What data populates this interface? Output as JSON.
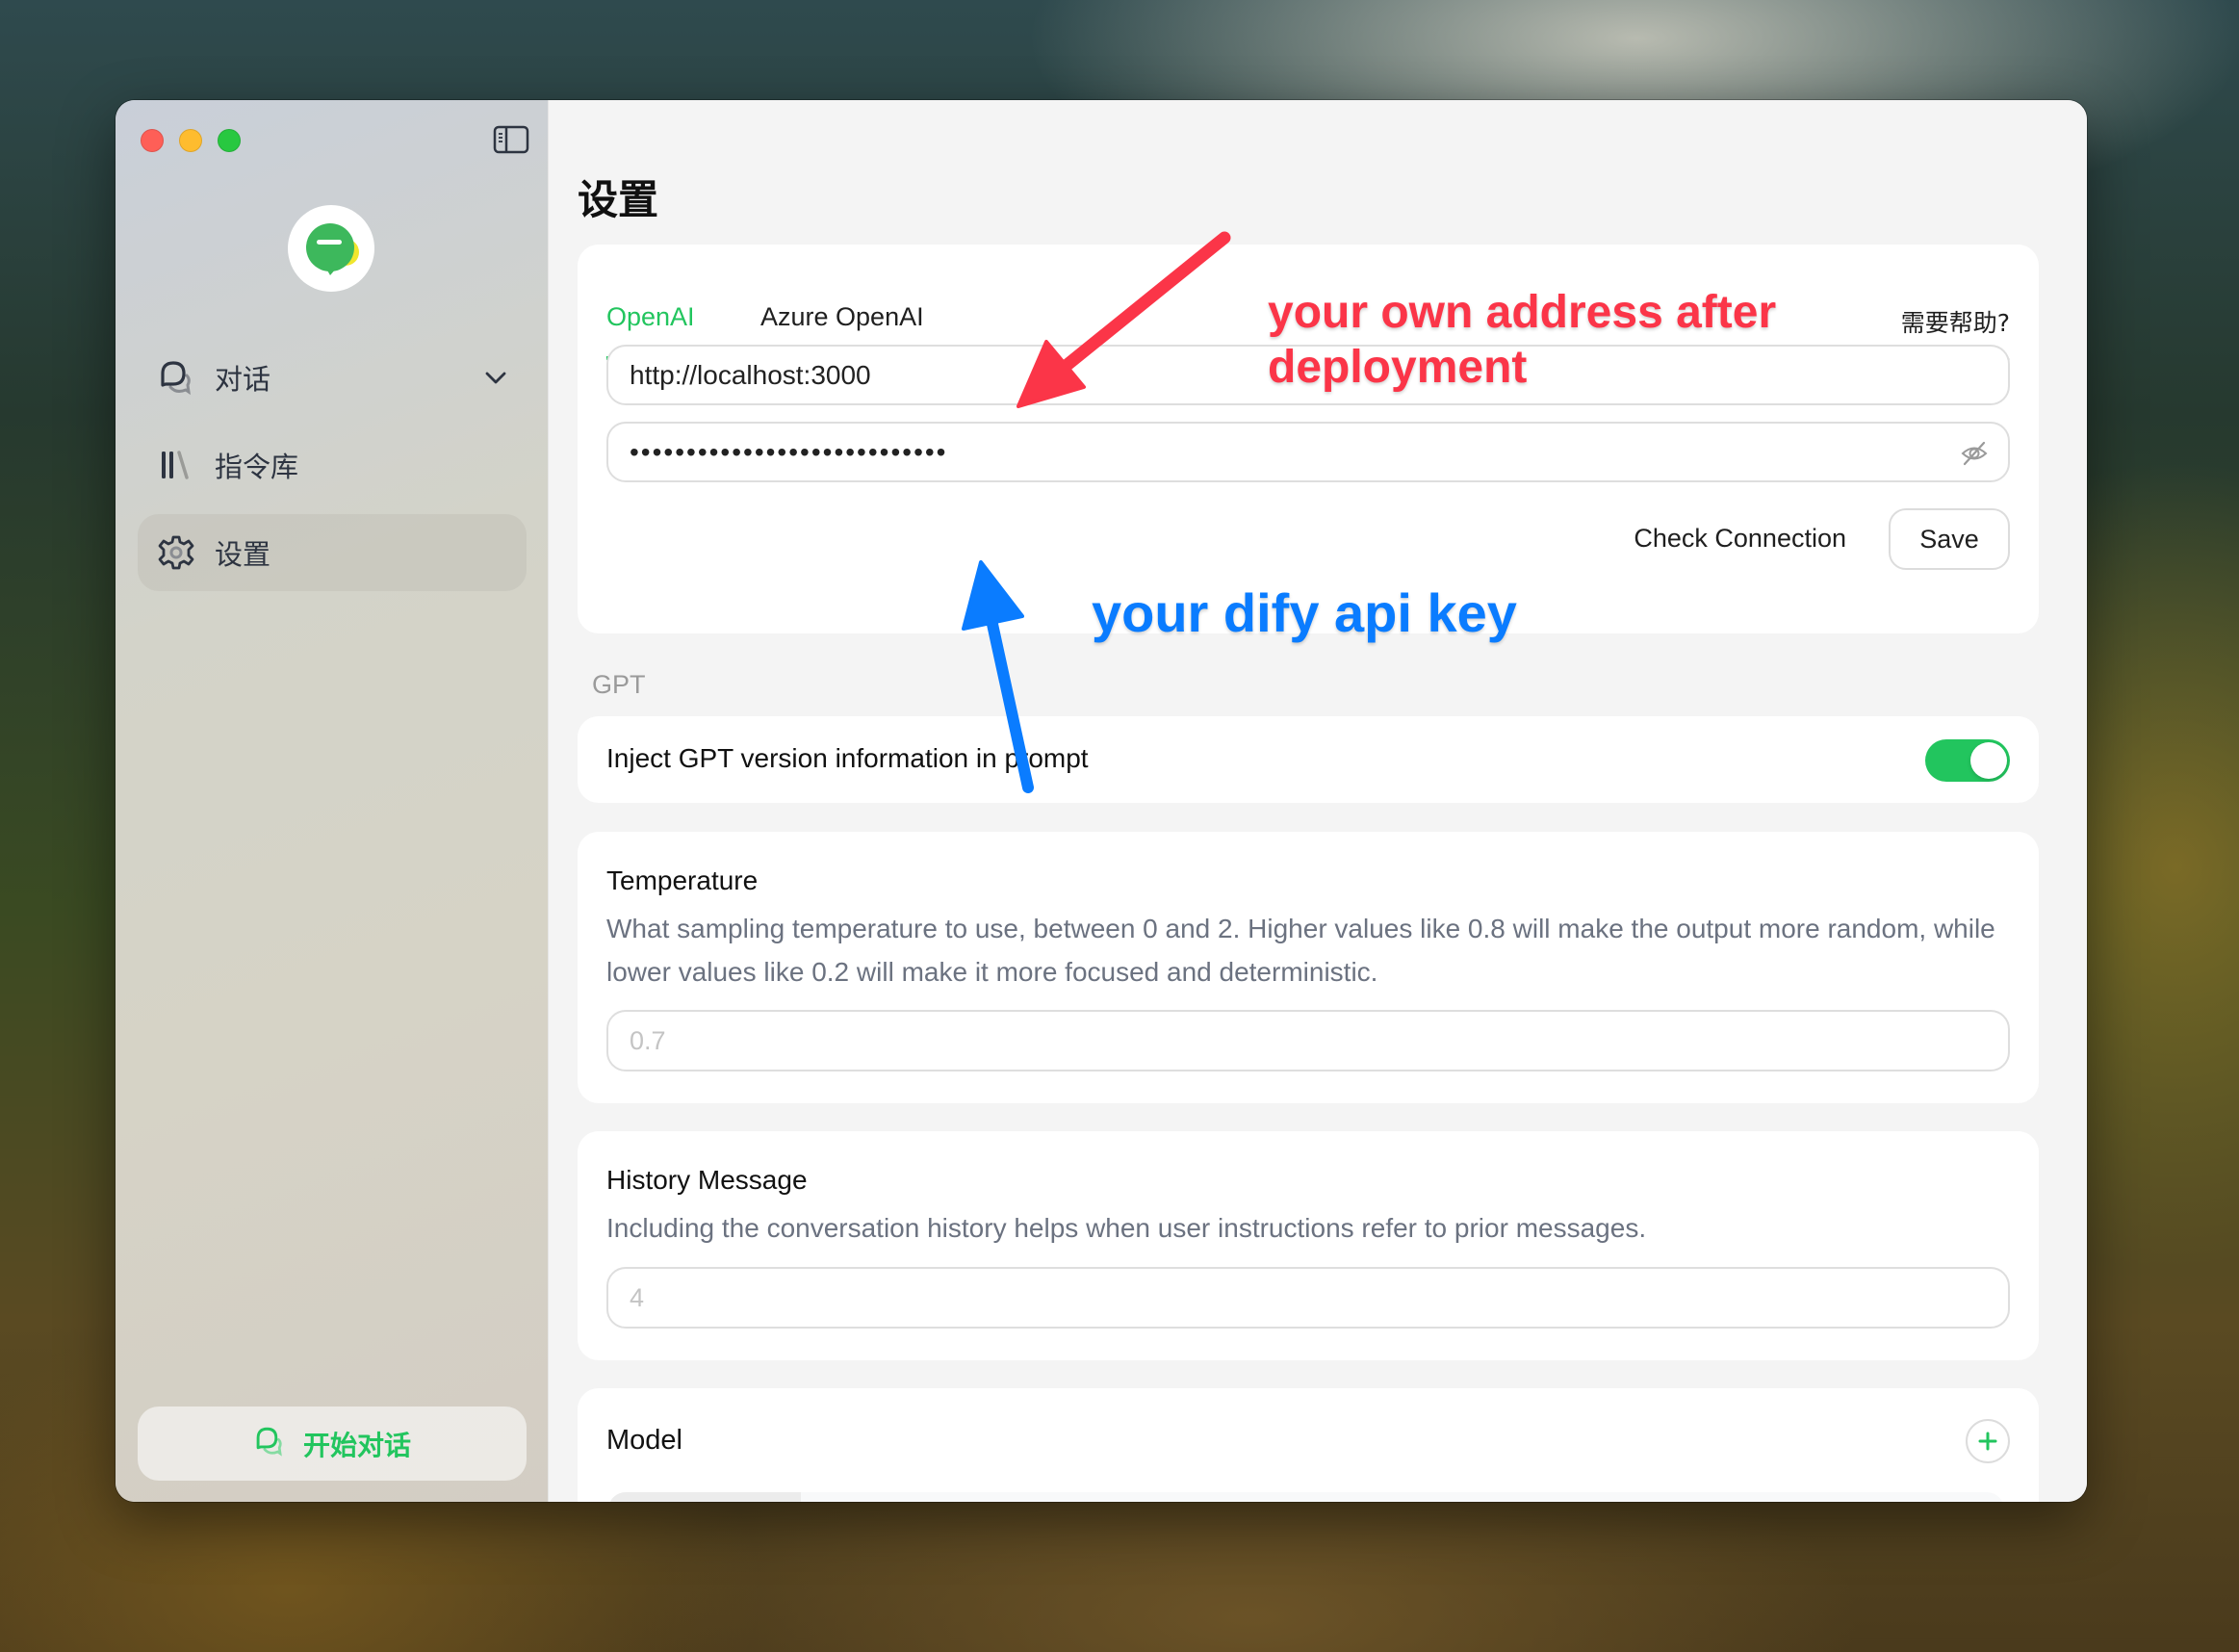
{
  "window": {
    "controls": [
      "close",
      "minimize",
      "maximize"
    ],
    "sidebar_toggle_icon": "sidebar-toggle-icon"
  },
  "sidebar": {
    "logo_icon": "chat-bubble-logo-icon",
    "items": [
      {
        "label": "对话",
        "icon": "chat-bubbles-icon",
        "has_chevron": true,
        "active": false
      },
      {
        "label": "指令库",
        "icon": "library-icon",
        "active": false
      },
      {
        "label": "设置",
        "icon": "gear-icon",
        "active": true
      }
    ],
    "new_chat_label": "开始对话",
    "new_chat_icon": "chat-bubbles-icon"
  },
  "main": {
    "title": "设置",
    "provider": {
      "tabs": [
        {
          "label": "OpenAI",
          "active": true
        },
        {
          "label": "Azure OpenAI",
          "active": false
        }
      ],
      "help_label": "需要帮助?",
      "url_value": "http://localhost:3000",
      "api_key_masked": "••••••••••••••••••••••••••••",
      "eye_icon": "eye-off-icon",
      "check_connection_label": "Check Connection",
      "save_label": "Save"
    },
    "gpt_section_label": "GPT",
    "inject": {
      "label": "Inject GPT version information in prompt",
      "enabled": true
    },
    "temperature": {
      "title": "Temperature",
      "description": "What sampling temperature to use, between 0 and 2. Higher values like 0.8 will make the output more random, while lower values like 0.2 will make it more focused and deterministic.",
      "placeholder": "0.7"
    },
    "history": {
      "title": "History Message",
      "description": "Including the conversation history helps when user instructions refer to prior messages.",
      "placeholder": "4"
    },
    "model": {
      "title": "Model",
      "add_icon": "plus-icon"
    }
  },
  "annotations": {
    "red_text": "your own address after deployment",
    "red_color": "#fb3548",
    "blue_text": "your dify api key",
    "blue_color": "#0a7cff"
  },
  "colors": {
    "accent": "#22c55e"
  }
}
